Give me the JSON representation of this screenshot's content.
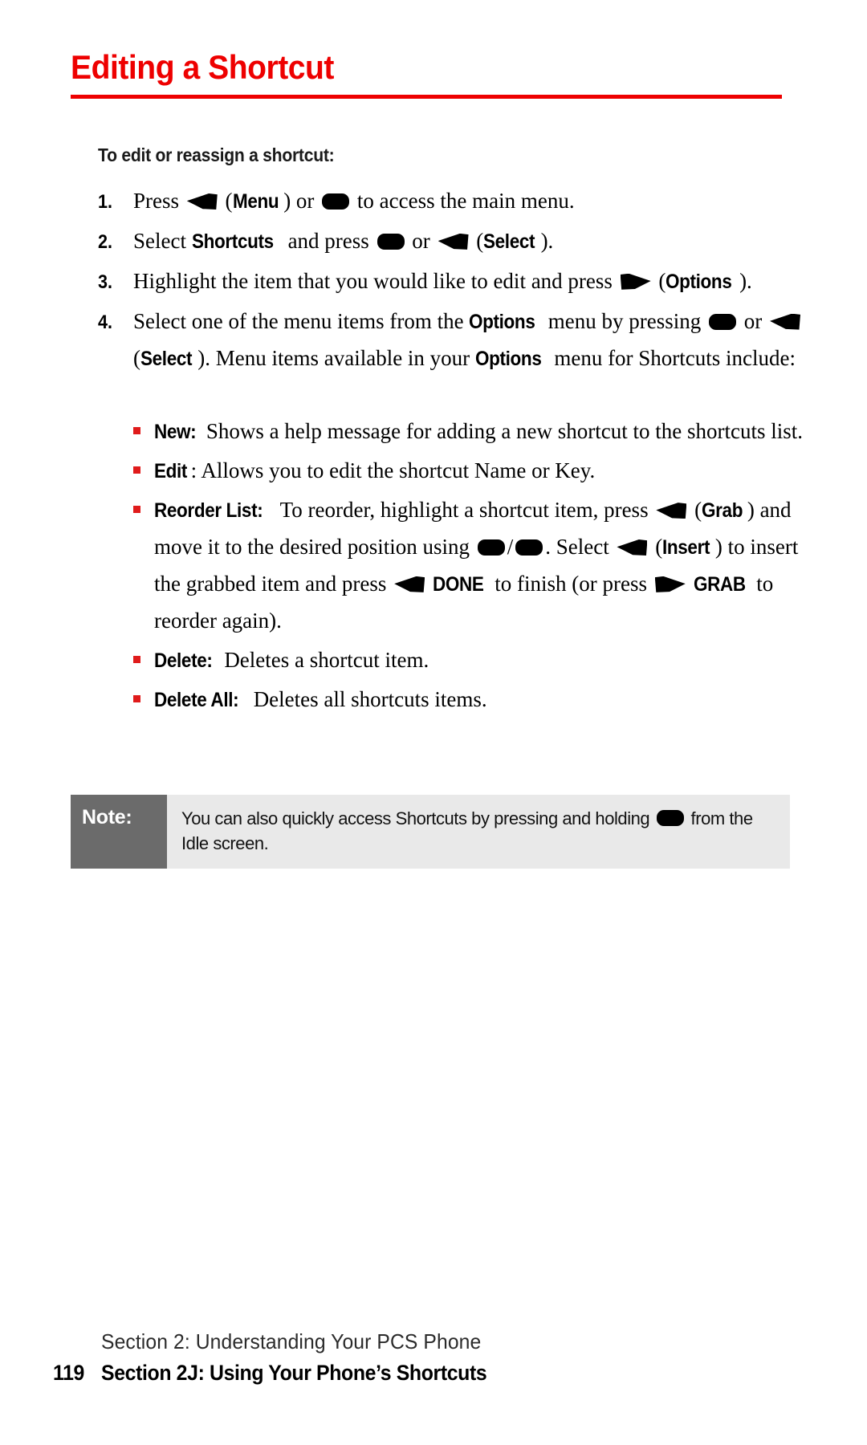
{
  "page": {
    "title": "Editing a Shortcut",
    "title_color": "#ee0000",
    "subheading": "To edit or reassign a shortcut:"
  },
  "steps": [
    {
      "number": "1.",
      "parts": [
        {
          "t": "text",
          "v": "Press "
        },
        {
          "t": "icon",
          "v": "softkey-left-icon"
        },
        {
          "t": "text",
          "v": " ("
        },
        {
          "t": "bold",
          "v": "Menu"
        },
        {
          "t": "text",
          "v": ") or "
        },
        {
          "t": "icon",
          "v": "ok-key-icon"
        },
        {
          "t": "text",
          "v": " to access the main menu."
        }
      ]
    },
    {
      "number": "2.",
      "parts": [
        {
          "t": "text",
          "v": "Select "
        },
        {
          "t": "bold",
          "v": "Shortcuts"
        },
        {
          "t": "text",
          "v": " and press "
        },
        {
          "t": "icon",
          "v": "ok-key-icon"
        },
        {
          "t": "text",
          "v": " or "
        },
        {
          "t": "icon",
          "v": "softkey-left-icon"
        },
        {
          "t": "text",
          "v": " ("
        },
        {
          "t": "bold",
          "v": "Select"
        },
        {
          "t": "text",
          "v": ")."
        }
      ]
    },
    {
      "number": "3.",
      "parts": [
        {
          "t": "text",
          "v": "Highlight the item that you would like to edit and press "
        },
        {
          "t": "icon",
          "v": "softkey-right-icon"
        },
        {
          "t": "text",
          "v": " ("
        },
        {
          "t": "bold",
          "v": "Options"
        },
        {
          "t": "text",
          "v": ")."
        }
      ]
    },
    {
      "number": "4.",
      "parts": [
        {
          "t": "text",
          "v": "Select one of the menu items from the "
        },
        {
          "t": "bold",
          "v": "Options"
        },
        {
          "t": "text",
          "v": " menu by pressing "
        },
        {
          "t": "icon",
          "v": "ok-key-icon"
        },
        {
          "t": "text",
          "v": " or "
        },
        {
          "t": "icon",
          "v": "softkey-left-icon"
        },
        {
          "t": "text",
          "v": " ("
        },
        {
          "t": "bold",
          "v": "Select"
        },
        {
          "t": "text",
          "v": "). Menu items available in your "
        },
        {
          "t": "bold",
          "v": "Options"
        },
        {
          "t": "text",
          "v": " menu for Shortcuts include:"
        }
      ]
    }
  ],
  "sublist": [
    {
      "label": "New:",
      "parts": [
        {
          "t": "bold",
          "v": "New:"
        },
        {
          "t": "text",
          "v": " Shows a help message for adding a new shortcut to the shortcuts list."
        }
      ]
    },
    {
      "label": "Edit",
      "parts": [
        {
          "t": "bold",
          "v": "Edit"
        },
        {
          "t": "text",
          "v": ": Allows you to edit the shortcut Name or Key."
        }
      ]
    },
    {
      "label": "Reorder List:",
      "parts": [
        {
          "t": "bold",
          "v": "Reorder List:"
        },
        {
          "t": "text",
          "v": " To reorder, highlight a shortcut item, press "
        },
        {
          "t": "icon",
          "v": "softkey-left-icon"
        },
        {
          "t": "text",
          "v": " ("
        },
        {
          "t": "bold",
          "v": "Grab"
        },
        {
          "t": "text",
          "v": ") and move it to the desired position using "
        },
        {
          "t": "icon",
          "v": "ok-key-icon"
        },
        {
          "t": "text",
          "v": "/"
        },
        {
          "t": "icon",
          "v": "ok-key-icon"
        },
        {
          "t": "text",
          "v": ". Select "
        },
        {
          "t": "icon",
          "v": "softkey-left-icon"
        },
        {
          "t": "text",
          "v": " ("
        },
        {
          "t": "bold",
          "v": "Insert"
        },
        {
          "t": "text",
          "v": ") to insert the grabbed item and press "
        },
        {
          "t": "icon",
          "v": "softkey-left-icon"
        },
        {
          "t": "text",
          "v": " "
        },
        {
          "t": "bold",
          "v": "DONE"
        },
        {
          "t": "text",
          "v": " to finish (or press "
        },
        {
          "t": "icon",
          "v": "softkey-right-icon"
        },
        {
          "t": "text",
          "v": " "
        },
        {
          "t": "bold",
          "v": "GRAB"
        },
        {
          "t": "text",
          "v": " to reorder again)."
        }
      ]
    },
    {
      "label": "Delete:",
      "parts": [
        {
          "t": "bold",
          "v": "Delete:"
        },
        {
          "t": "text",
          "v": " Deletes a shortcut item."
        }
      ]
    },
    {
      "label": "Delete All:",
      "parts": [
        {
          "t": "bold",
          "v": "Delete All:"
        },
        {
          "t": "text",
          "v": " Deletes all shortcuts items."
        }
      ]
    }
  ],
  "note": {
    "label": "Note:",
    "parts": [
      {
        "t": "text",
        "v": "You can also quickly access Shortcuts by pressing and holding "
      },
      {
        "t": "icon",
        "v": "ok-key-icon"
      },
      {
        "t": "text",
        "v": " from the Idle screen."
      }
    ],
    "label_bg": "#6b6b6b",
    "body_bg": "#e9e9e9"
  },
  "footer": {
    "section_line": "Section 2: Understanding Your PCS Phone",
    "page_number": "119",
    "section_title": "Section 2J: Using Your Phone’s Shortcuts"
  }
}
